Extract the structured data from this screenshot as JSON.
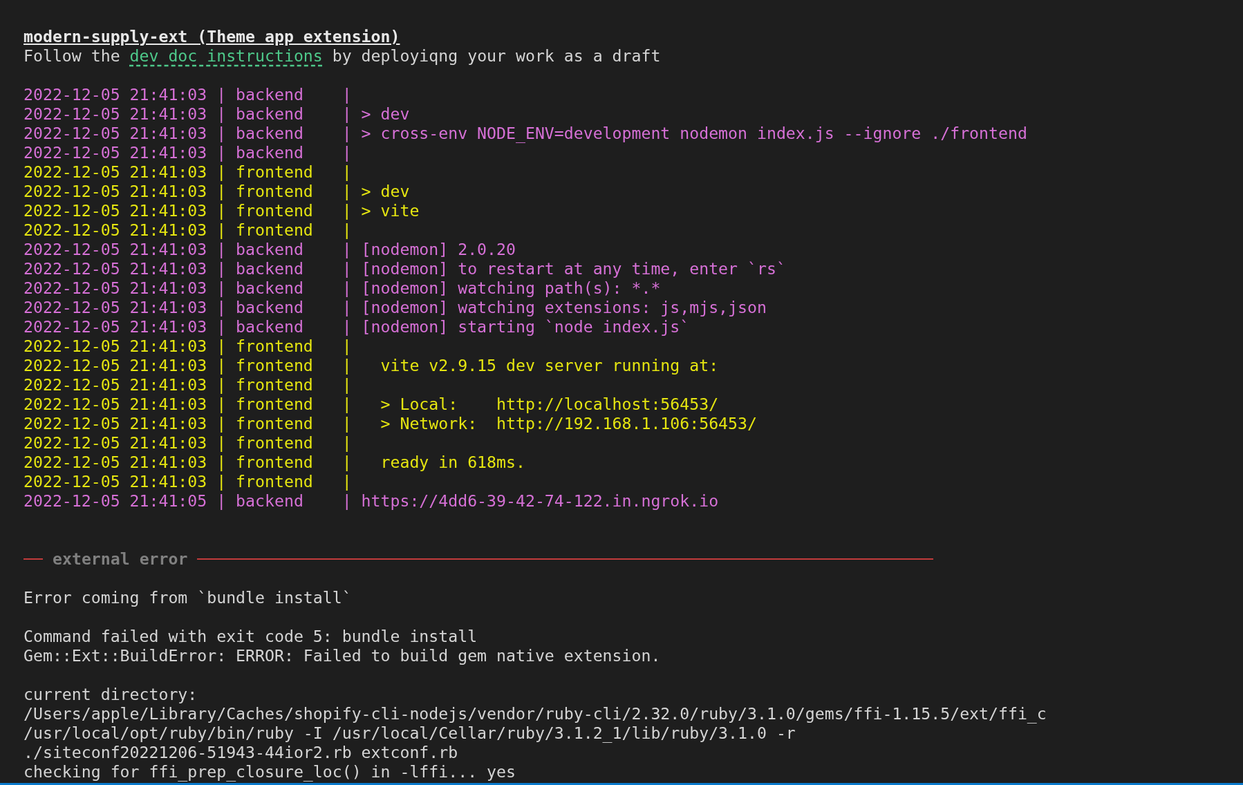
{
  "extension": {
    "title": "modern-supply-ext (Theme app extension)",
    "before_link": "Follow the",
    "link": "dev doc instructions",
    "after_link": "by deployiqng your work as a draft"
  },
  "log_lines": [
    {
      "text": "2022-12-05 21:41:03 | backend    |",
      "color": "#d670d6"
    },
    {
      "text": "2022-12-05 21:41:03 | backend    | > dev",
      "color": "#d670d6"
    },
    {
      "text": "2022-12-05 21:41:03 | backend    | > cross-env NODE_ENV=development nodemon index.js --ignore ./frontend",
      "color": "#d670d6"
    },
    {
      "text": "2022-12-05 21:41:03 | backend    |",
      "color": "#d670d6"
    },
    {
      "text": "2022-12-05 21:41:03 | frontend   |",
      "color": "#e5e510"
    },
    {
      "text": "2022-12-05 21:41:03 | frontend   | > dev",
      "color": "#e5e510"
    },
    {
      "text": "2022-12-05 21:41:03 | frontend   | > vite",
      "color": "#e5e510"
    },
    {
      "text": "2022-12-05 21:41:03 | frontend   |",
      "color": "#e5e510"
    },
    {
      "text": "2022-12-05 21:41:03 | backend    | [nodemon] 2.0.20",
      "color": "#d670d6"
    },
    {
      "text": "2022-12-05 21:41:03 | backend    | [nodemon] to restart at any time, enter `rs`",
      "color": "#d670d6"
    },
    {
      "text": "2022-12-05 21:41:03 | backend    | [nodemon] watching path(s): *.*",
      "color": "#d670d6"
    },
    {
      "text": "2022-12-05 21:41:03 | backend    | [nodemon] watching extensions: js,mjs,json",
      "color": "#d670d6"
    },
    {
      "text": "2022-12-05 21:41:03 | backend    | [nodemon] starting `node index.js`",
      "color": "#d670d6"
    },
    {
      "text": "2022-12-05 21:41:03 | frontend   |",
      "color": "#e5e510"
    },
    {
      "text": "2022-12-05 21:41:03 | frontend   |   vite v2.9.15 dev server running at:",
      "color": "#e5e510"
    },
    {
      "text": "2022-12-05 21:41:03 | frontend   |",
      "color": "#e5e510"
    },
    {
      "text": "2022-12-05 21:41:03 | frontend   |   > Local:    http://localhost:56453/",
      "color": "#e5e510"
    },
    {
      "text": "2022-12-05 21:41:03 | frontend   |   > Network:  http://192.168.1.106:56453/",
      "color": "#e5e510"
    },
    {
      "text": "2022-12-05 21:41:03 | frontend   |",
      "color": "#e5e510"
    },
    {
      "text": "2022-12-05 21:41:03 | frontend   |   ready in 618ms.",
      "color": "#e5e510"
    },
    {
      "text": "2022-12-05 21:41:03 | frontend   |",
      "color": "#e5e510"
    },
    {
      "text": "2022-12-05 21:41:05 | backend    | https://4dd6-39-42-74-122.in.ngrok.io",
      "color": "#d670d6"
    }
  ],
  "error": {
    "heading": "external error",
    "blocks": [
      [
        "Error coming from `bundle install`"
      ],
      [
        "Command failed with exit code 5: bundle install",
        "Gem::Ext::BuildError: ERROR: Failed to build gem native extension."
      ],
      [
        "current directory:",
        "/Users/apple/Library/Caches/shopify-cli-nodejs/vendor/ruby-cli/2.32.0/ruby/3.1.0/gems/ffi-1.15.5/ext/ffi_c",
        "/usr/local/opt/ruby/bin/ruby -I /usr/local/Cellar/ruby/3.1.2_1/lib/ruby/3.1.0 -r",
        "./siteconf20221206-51943-44ior2.rb extconf.rb",
        "checking for ffi_prep_closure_loc() in -lffi... yes"
      ]
    ]
  }
}
